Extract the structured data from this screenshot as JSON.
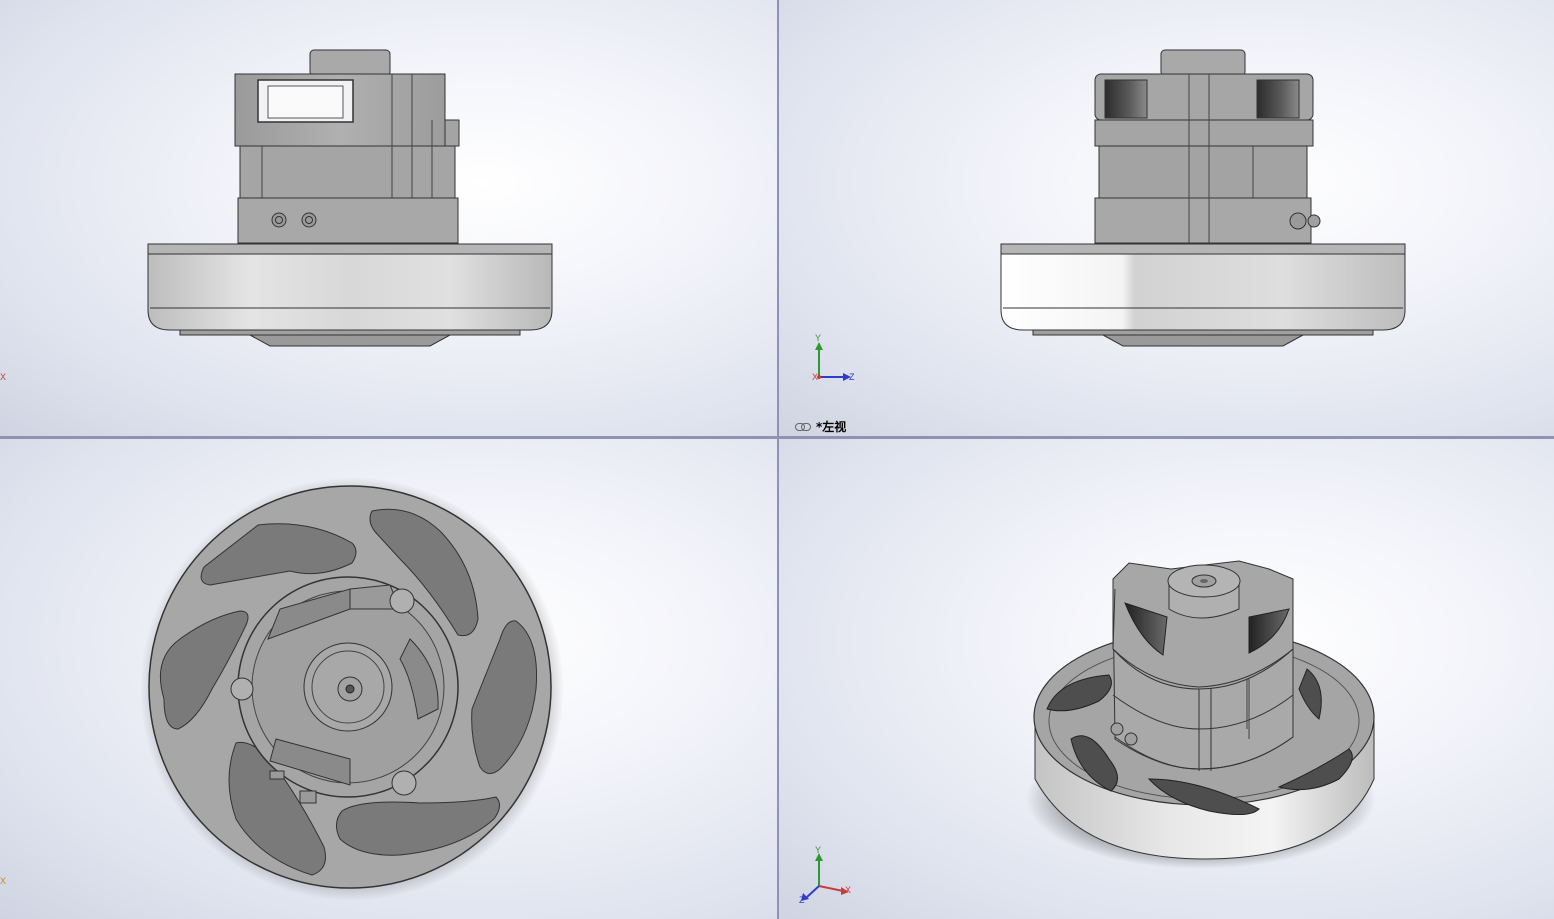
{
  "views": {
    "front": {
      "axis_stub": "X",
      "axis_stub_color": "#c83c3c"
    },
    "left": {
      "name": "*左视",
      "triad": {
        "x": "X",
        "y": "Y",
        "z": "Z"
      }
    },
    "bottom": {
      "axis_stub": "X",
      "axis_stub_color": "#d08a1e"
    },
    "isometric": {
      "triad": {
        "x": "X",
        "y": "Y",
        "z": "Z"
      }
    }
  },
  "colors": {
    "viewport_background": "#e8eaf2",
    "splitter": "#8e93b2",
    "model_body": "#a8a8a8",
    "model_dark": "#6e6e6e",
    "axis_x": "#c83c3c",
    "axis_y": "#2e9a2e",
    "axis_z": "#2e3cc8"
  }
}
